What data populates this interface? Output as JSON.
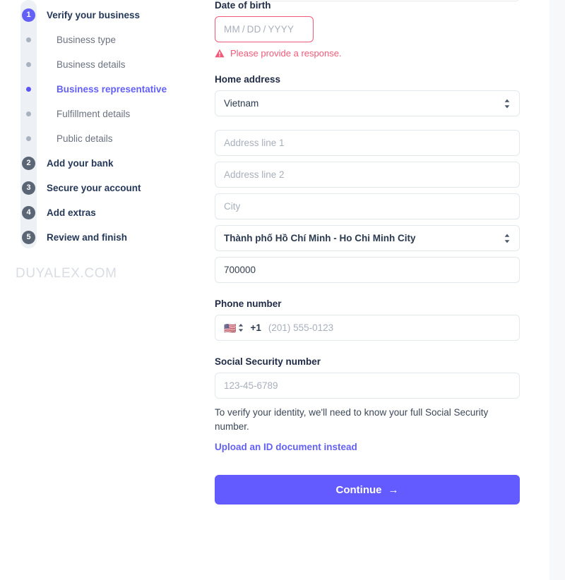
{
  "sidebar": {
    "steps": [
      {
        "kind": "num",
        "marker": "1",
        "label": "Verify your business",
        "state": "active"
      },
      {
        "kind": "dot",
        "marker": "",
        "label": "Business type",
        "state": "idle"
      },
      {
        "kind": "dot",
        "marker": "",
        "label": "Business details",
        "state": "idle"
      },
      {
        "kind": "dot",
        "marker": "",
        "label": "Business representative",
        "state": "current"
      },
      {
        "kind": "dot",
        "marker": "",
        "label": "Fulfillment details",
        "state": "idle"
      },
      {
        "kind": "dot",
        "marker": "",
        "label": "Public details",
        "state": "idle"
      },
      {
        "kind": "num",
        "marker": "2",
        "label": "Add your bank",
        "state": "idle"
      },
      {
        "kind": "num",
        "marker": "3",
        "label": "Secure your account",
        "state": "idle"
      },
      {
        "kind": "num",
        "marker": "4",
        "label": "Add extras",
        "state": "idle"
      },
      {
        "kind": "num",
        "marker": "5",
        "label": "Review and finish",
        "state": "idle"
      }
    ]
  },
  "form": {
    "dob": {
      "label": "Date of birth",
      "mm": "MM",
      "dd": "DD",
      "yyyy": "YYYY",
      "slash": "/",
      "error": "Please provide a response.",
      "error_icon": "warning-triangle-icon"
    },
    "home_address": {
      "label": "Home address",
      "country": "Vietnam",
      "address_line_1_placeholder": "Address line 1",
      "address_line_2_placeholder": "Address line 2",
      "city_placeholder": "City",
      "province": "Thành phố Hồ Chí Minh - Ho Chi Minh City",
      "postal_code": "700000",
      "select_icon": "chevron-updown-icon"
    },
    "phone": {
      "label": "Phone number",
      "flag": "🇺🇸",
      "country_code": "+1",
      "placeholder": "(201) 555-0123",
      "select_icon": "chevron-updown-icon"
    },
    "ssn": {
      "label": "Social Security number",
      "placeholder": "123-45-6789",
      "help": "To verify your identity, we'll need to know your full Social Security number.",
      "link": "Upload an ID document instead"
    },
    "submit": {
      "label": "Continue",
      "arrow": "→"
    }
  },
  "watermark": {
    "text": "DUYALEX.COM"
  },
  "colors": {
    "brand_purple": "#635bff",
    "active_link": "#6360f5",
    "error_pink": "#ef5a78",
    "step_gray": "#5a6676",
    "track_gray": "#edf0f4",
    "border_gray": "#e3e8ee",
    "placeholder_gray": "#a8b0bd",
    "heading_navy": "#253858",
    "gutter_gray": "#f6f8fa"
  }
}
